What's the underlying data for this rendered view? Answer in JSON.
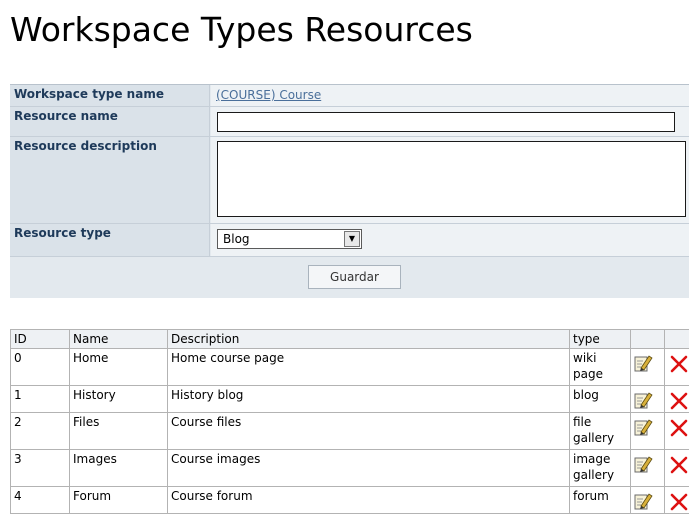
{
  "page": {
    "title": "Workspace Types Resources"
  },
  "form": {
    "workspace_type_label": "Workspace type name",
    "workspace_type_value": "(COURSE) Course",
    "resource_name_label": "Resource name",
    "resource_name_value": "",
    "resource_description_label": "Resource description",
    "resource_description_value": "",
    "resource_type_label": "Resource type",
    "resource_type_selected": "Blog",
    "save_label": "Guardar"
  },
  "table": {
    "headers": {
      "id": "ID",
      "name": "Name",
      "description": "Description",
      "type": "type"
    },
    "rows": [
      {
        "id": "0",
        "name": "Home",
        "description": "Home course page",
        "type": "wiki page"
      },
      {
        "id": "1",
        "name": "History",
        "description": "History blog",
        "type": "blog"
      },
      {
        "id": "2",
        "name": "Files",
        "description": "Course files",
        "type": "file gallery"
      },
      {
        "id": "3",
        "name": "Images",
        "description": "Course images",
        "type": "image gallery"
      },
      {
        "id": "4",
        "name": "Forum",
        "description": "Course forum",
        "type": "forum"
      }
    ]
  },
  "icons": {
    "edit": "edit-icon",
    "delete": "delete-icon"
  },
  "colors": {
    "panel_background": "#e3e9ee",
    "label_text": "#1e3a5a",
    "link": "#4a6f9a",
    "delete_red": "#dd1111"
  }
}
